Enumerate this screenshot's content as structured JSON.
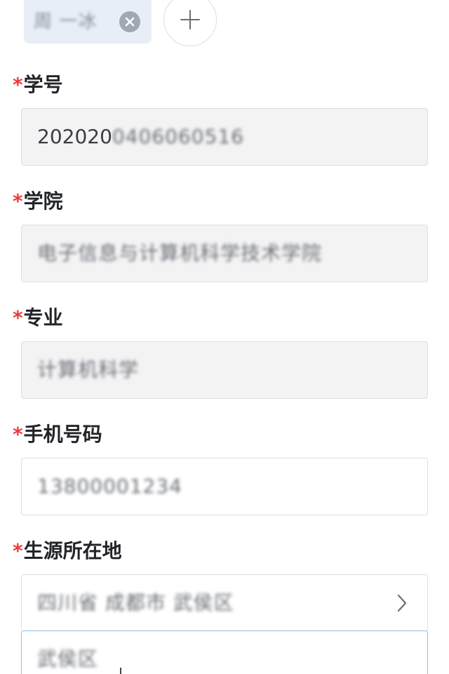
{
  "attachment": {
    "tag_text": "周 一冰"
  },
  "fields": [
    {
      "label": "学号",
      "value_prefix": "202020",
      "value_rest": "0406060516"
    },
    {
      "label": "学院",
      "value": "电子信息与计算机科学技术学院"
    },
    {
      "label": "专业",
      "value": "计算机科学"
    },
    {
      "label": "手机号码",
      "value": "13800001234"
    },
    {
      "label": "生源所在地",
      "value": "四川省 成都市 武侯区",
      "value2": "武侯区"
    }
  ],
  "required_mark": "*",
  "colors": {
    "required": "#ee3b3b",
    "active_border": "#8fc2ec",
    "readonly_bg": "#f3f3f4"
  },
  "icons": [
    "close-icon",
    "plus-icon",
    "chevron-right-icon"
  ]
}
